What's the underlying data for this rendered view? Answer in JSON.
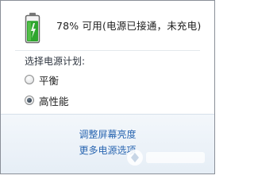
{
  "battery": {
    "icon": "battery-charging-icon",
    "percent": 78,
    "status_text": "78% 可用(电源已接通，未充电)",
    "colors": {
      "fill": "#2ea52e",
      "outline": "#6a6a6a"
    }
  },
  "power_plan": {
    "label": "选择电源计划:",
    "options": [
      {
        "label": "平衡",
        "selected": false
      },
      {
        "label": "高性能",
        "selected": true
      }
    ]
  },
  "footer": {
    "adjust_brightness_link": "调整屏幕亮度",
    "more_options_link": "更多电源选项"
  },
  "colors": {
    "link": "#2a66b1",
    "footer_background": "#eaf1f8"
  }
}
